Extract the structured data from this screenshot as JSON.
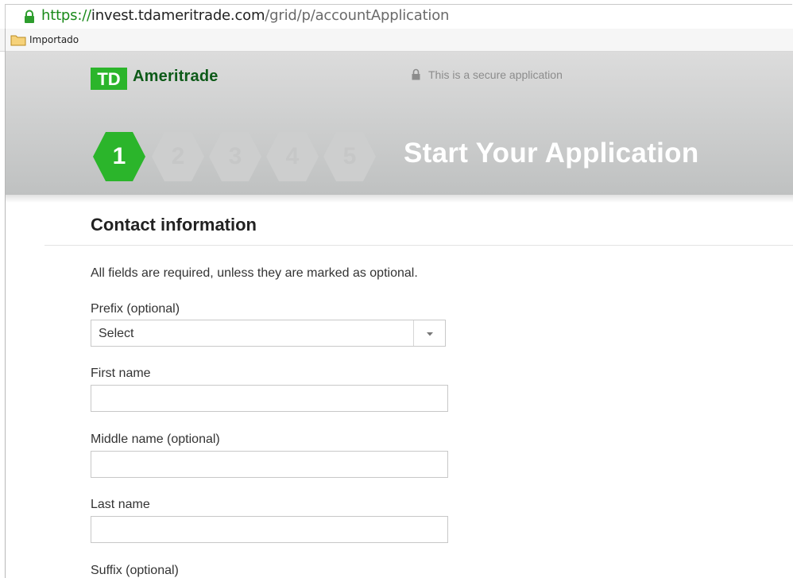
{
  "browser": {
    "url_scheme": "https://",
    "url_host": "invest.tdameritrade.com",
    "url_path": "/grid/p/accountApplication",
    "bookmark_folder": "Importado"
  },
  "header": {
    "logo_text": "TD",
    "brand_name": "Ameritrade",
    "secure_text": "This is a secure application",
    "page_title": "Start Your Application",
    "steps": [
      "1",
      "2",
      "3",
      "4",
      "5"
    ],
    "active_step": "1"
  },
  "colors": {
    "brand_green": "#2bb52b",
    "brand_dark_green": "#0d5a18",
    "step_inactive": "#cdcece"
  },
  "form": {
    "section_title": "Contact information",
    "intro": "All fields are required, unless they are marked as optional.",
    "prefix": {
      "label": "Prefix (optional)",
      "selected": "Select"
    },
    "first_name": {
      "label": "First name",
      "value": ""
    },
    "middle_name": {
      "label": "Middle name (optional)",
      "value": ""
    },
    "last_name": {
      "label": "Last name",
      "value": ""
    },
    "suffix": {
      "label": "Suffix (optional)"
    }
  }
}
